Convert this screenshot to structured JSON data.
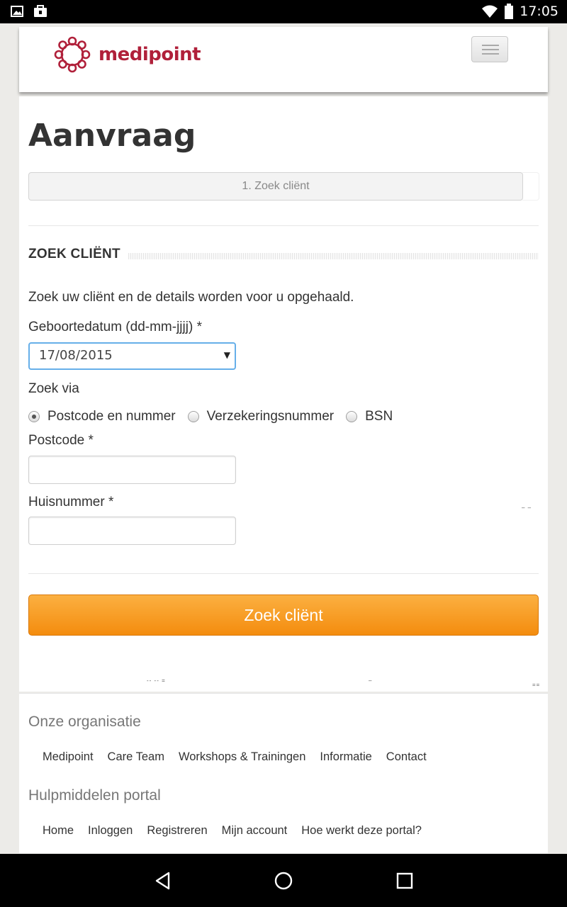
{
  "status_bar": {
    "time": "17:05"
  },
  "header": {
    "logo_text": "medipoint",
    "brand_color": "#b0203a"
  },
  "page": {
    "title": "Aanvraag",
    "step": "1. Zoek cliënt",
    "section_title": "ZOEK CLIËNT",
    "intro": "Zoek uw cliënt en de details worden voor u opgehaald.",
    "birthdate_label": "Geboortedatum (dd-mm-jjjj) *",
    "birthdate_value": "17/08/2015",
    "search_via_label": "Zoek via",
    "radio_options": [
      "Postcode en nummer",
      "Verzekeringsnummer",
      "BSN"
    ],
    "selected_option": "Postcode en nummer",
    "postcode_label": "Postcode *",
    "postcode_value": "",
    "huisnummer_label": "Huisnummer *",
    "huisnummer_value": "",
    "submit_label": "Zoek cliënt",
    "accent_color": "#f5950f"
  },
  "footer": {
    "org_title": "Onze organisatie",
    "org_links": [
      "Medipoint",
      "Care Team",
      "Workshops & Trainingen",
      "Informatie",
      "Contact"
    ],
    "portal_title": "Hulpmiddelen portal",
    "portal_links": [
      "Home",
      "Inloggen",
      "Registreren",
      "Mijn account",
      "Hoe werkt deze portal?"
    ]
  }
}
